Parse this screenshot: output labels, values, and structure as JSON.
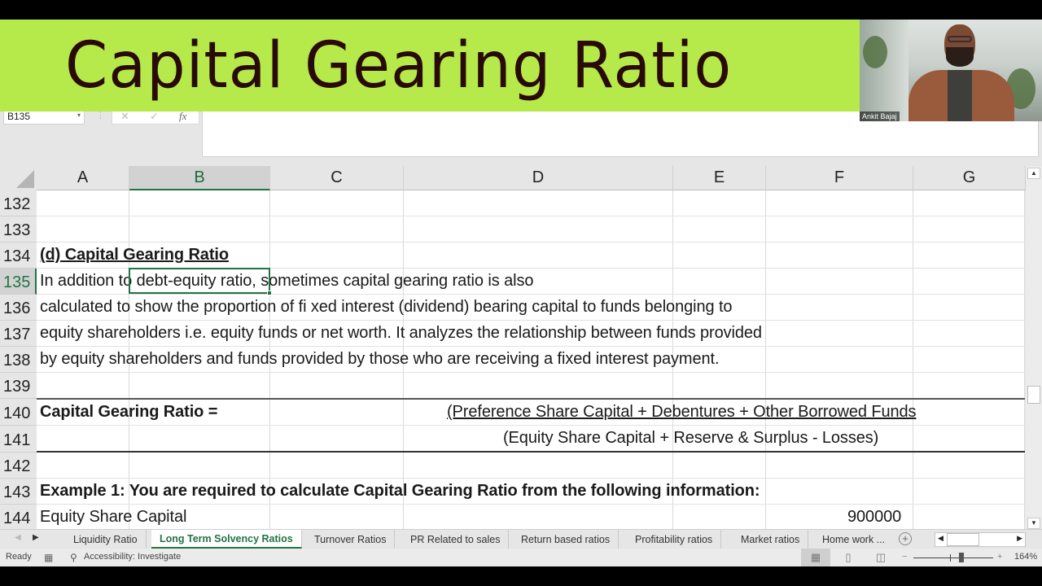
{
  "banner": {
    "title": "Capital Gearing Ratio",
    "background": "#b5ea4a",
    "text_color": "#2a0a08"
  },
  "webcam": {
    "participant_name": "Ankit Bajaj"
  },
  "formula_bar": {
    "name_box": "B135",
    "cancel_icon": "✕",
    "enter_icon": "✓",
    "fx_label": "fx",
    "formula": ""
  },
  "columns": [
    "A",
    "B",
    "C",
    "D",
    "E",
    "F",
    "G"
  ],
  "selected_column": "B",
  "rows": [
    {
      "num": "132",
      "cells": []
    },
    {
      "num": "133",
      "cells": []
    },
    {
      "num": "134",
      "cells": [
        {
          "col": "A",
          "text": "(d) Capital Gearing Ratio",
          "bold": true,
          "underline": true
        }
      ]
    },
    {
      "num": "135",
      "cells": [
        {
          "col": "A",
          "text": "In addition to debt-equity ratio, sometimes capital gearing ratio is also"
        }
      ]
    },
    {
      "num": "136",
      "cells": [
        {
          "col": "A",
          "text": "calculated to show the proportion of fi xed interest (dividend) bearing capital to funds belonging to"
        }
      ]
    },
    {
      "num": "137",
      "cells": [
        {
          "col": "A",
          "text": "equity shareholders i.e. equity funds or net worth. It analyzes the relationship between funds provided"
        }
      ]
    },
    {
      "num": "138",
      "cells": [
        {
          "col": "A",
          "text": "by equity shareholders and funds provided by those who are receiving a fixed interest payment."
        }
      ]
    },
    {
      "num": "139",
      "cells": []
    },
    {
      "num": "140",
      "cells": [
        {
          "col": "A",
          "text": "Capital Gearing Ratio =",
          "bold": true
        },
        {
          "col": "D",
          "text": "(Preference Share Capital + Debentures + Other Borrowed Funds",
          "underline": true
        }
      ]
    },
    {
      "num": "141",
      "cells": [
        {
          "col": "D",
          "text": "(Equity Share Capital + Reserve & Surplus - Losses)"
        }
      ]
    },
    {
      "num": "142",
      "cells": []
    },
    {
      "num": "143",
      "cells": [
        {
          "col": "A",
          "text": "Example 1: You are required to calculate Capital Gearing Ratio from the following information:",
          "bold": true
        }
      ]
    },
    {
      "num": "144",
      "cells": [
        {
          "col": "A",
          "text": "Equity Share Capital"
        },
        {
          "col": "F",
          "text": "900000"
        }
      ]
    }
  ],
  "active_cell": "B135",
  "sheet_tabs": [
    {
      "label": "Liquidity Ratio",
      "active": false
    },
    {
      "label": "Long Term Solvency Ratios",
      "active": true
    },
    {
      "label": "Turnover Ratios",
      "active": false
    },
    {
      "label": "PR Related to sales",
      "active": false
    },
    {
      "label": "Return based ratios",
      "active": false
    },
    {
      "label": "Profitability ratios",
      "active": false
    },
    {
      "label": "Market ratios",
      "active": false
    },
    {
      "label": "Home work ...",
      "active": false
    }
  ],
  "status_bar": {
    "ready": "Ready",
    "accessibility": "Accessibility: Investigate",
    "zoom_level": "164%",
    "zoom_minus": "−",
    "zoom_plus": "+"
  },
  "icons": {
    "add_sheet": "+",
    "scroll_up": "▲",
    "scroll_down": "▼",
    "scroll_left": "◀",
    "scroll_right": "▶",
    "tab_prev": "◀",
    "tab_next": "▶",
    "dropdown": "▾"
  },
  "accent_color": "#217346"
}
